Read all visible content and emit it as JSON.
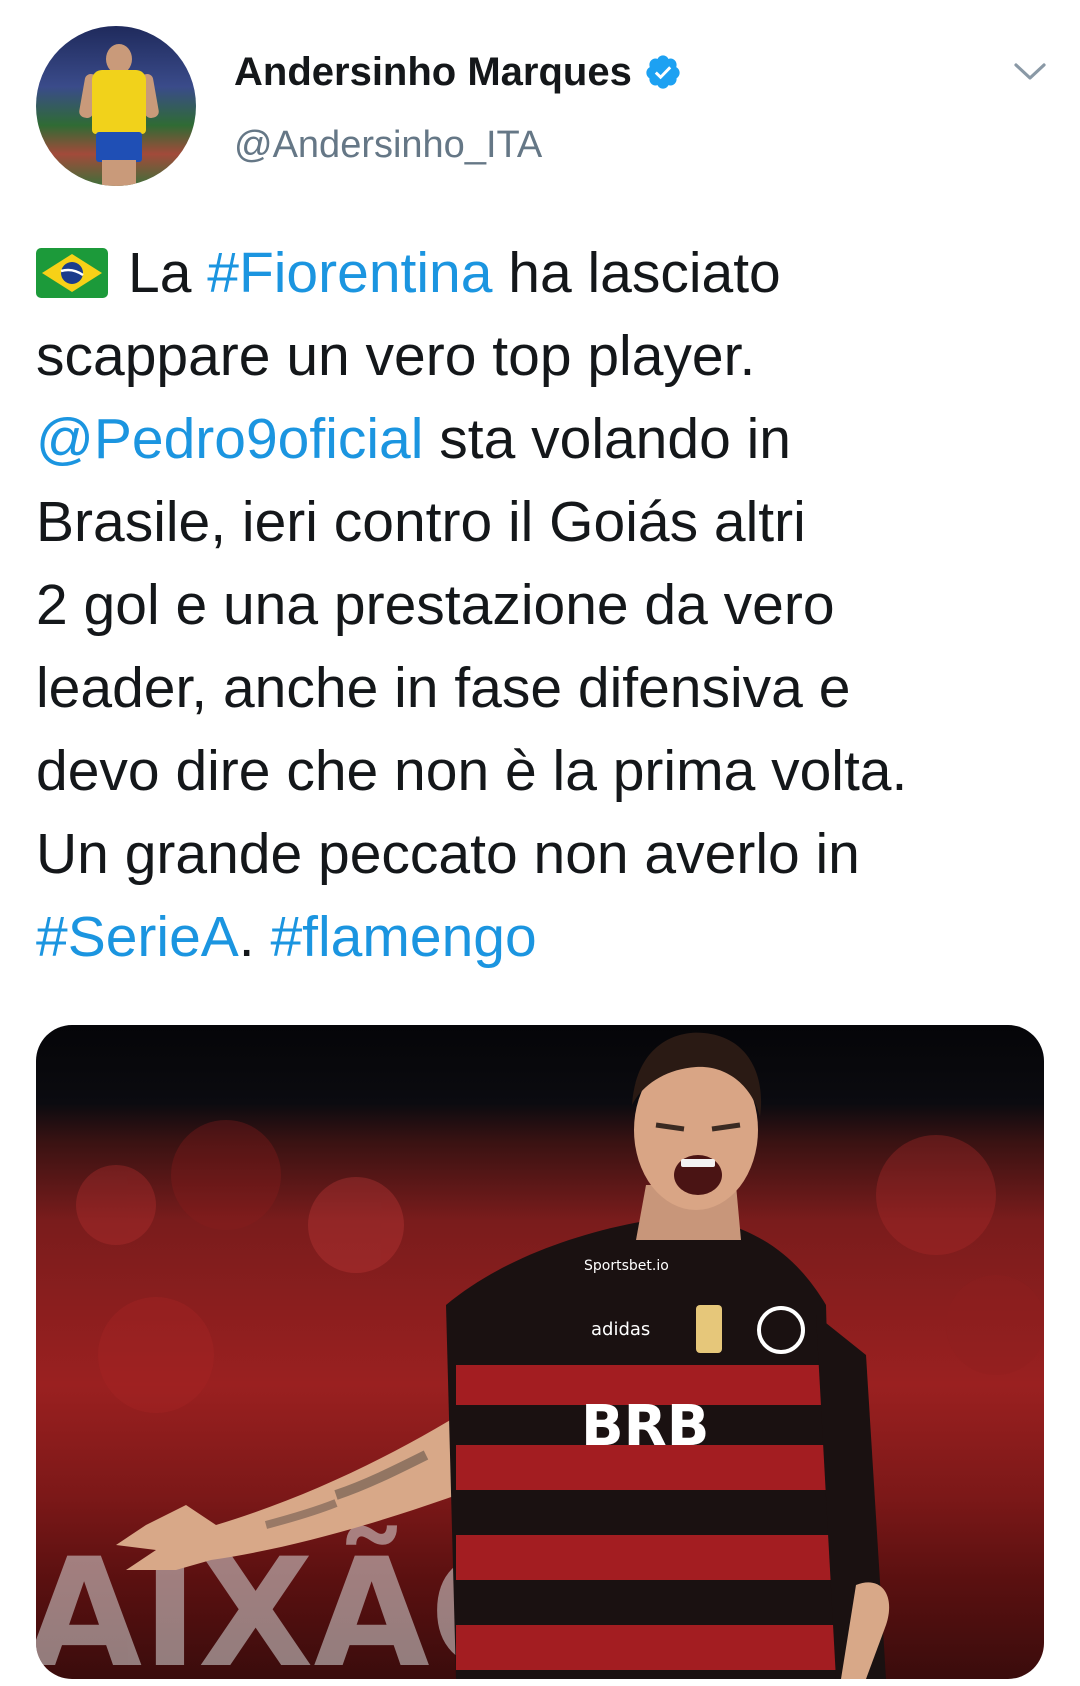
{
  "author": {
    "display_name": "Andersinho Marques",
    "handle": "@Andersinho_ITA",
    "verified": true
  },
  "tweet": {
    "lines": [
      [
        {
          "t": "flag"
        },
        {
          "t": "text",
          "v": "La "
        },
        {
          "t": "link",
          "v": "#Fiorentina"
        },
        {
          "t": "text",
          "v": " ha lasciato"
        }
      ],
      [
        {
          "t": "text",
          "v": "scappare un vero top player."
        }
      ],
      [
        {
          "t": "link",
          "v": "@Pedro9oficial"
        },
        {
          "t": "text",
          "v": " sta volando in"
        }
      ],
      [
        {
          "t": "text",
          "v": "Brasile, ieri contro il Goiás altri"
        }
      ],
      [
        {
          "t": "text",
          "v": "2 gol e una prestazione da vero"
        }
      ],
      [
        {
          "t": "text",
          "v": "leader, anche in fase difensiva e"
        }
      ],
      [
        {
          "t": "text",
          "v": "devo dire che non è la prima volta."
        }
      ],
      [
        {
          "t": "text",
          "v": "Un grande peccato non averlo in"
        }
      ],
      [
        {
          "t": "link",
          "v": "#SerieA"
        },
        {
          "t": "text",
          "v": ". "
        },
        {
          "t": "link",
          "v": "#flamengo"
        }
      ]
    ]
  },
  "media": {
    "jersey_sponsor": "BRB",
    "jersey_brand": "adidas",
    "sleeve_text": "Sportsbet.io",
    "background_text": "AIXÃO"
  },
  "colors": {
    "link": "#1b95e0",
    "verified": "#1da1f2",
    "text": "#14171a",
    "muted": "#657786"
  },
  "icons": {
    "verified": "verified-badge-icon",
    "menu": "chevron-down-icon",
    "flag": "brazil-flag-icon"
  }
}
